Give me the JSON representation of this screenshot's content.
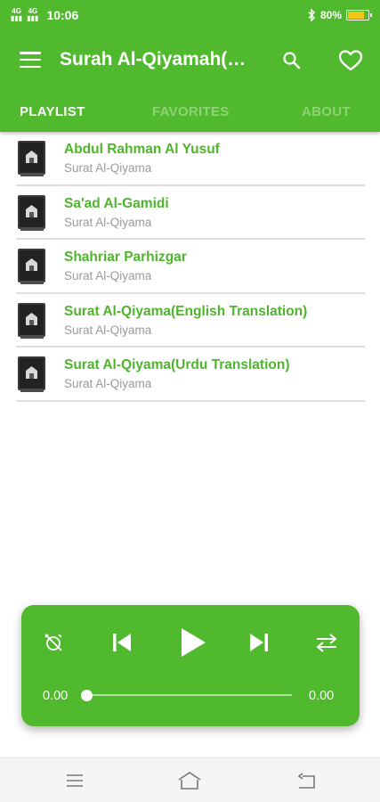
{
  "status_bar": {
    "network_1": "4G",
    "network_2": "4G",
    "time": "10:06",
    "battery": "80%",
    "battery_level": 0.8
  },
  "app_bar": {
    "title": "Surah Al-Qiyamah(…"
  },
  "tabs": [
    {
      "label": "PLAYLIST",
      "active": true
    },
    {
      "label": "FAVORITES",
      "active": false
    },
    {
      "label": "ABOUT",
      "active": false
    }
  ],
  "playlist": [
    {
      "title": "Abdul Rahman Al Yusuf",
      "subtitle": "Surat Al-Qiyama"
    },
    {
      "title": "Sa'ad Al-Gamidi",
      "subtitle": "Surat Al-Qiyama"
    },
    {
      "title": "Shahriar Parhizgar",
      "subtitle": "Surat Al-Qiyama"
    },
    {
      "title": "Surat Al-Qiyama(English Translation)",
      "subtitle": "Surat Al-Qiyama"
    },
    {
      "title": "Surat Al-Qiyama(Urdu Translation)",
      "subtitle": "Surat Al-Qiyama"
    }
  ],
  "player": {
    "current_time": "0.00",
    "total_time": "0.00",
    "progress": 0
  },
  "colors": {
    "accent": "#51b92d",
    "title_green": "#4eb52c",
    "subtitle_gray": "#9a9a9a"
  }
}
